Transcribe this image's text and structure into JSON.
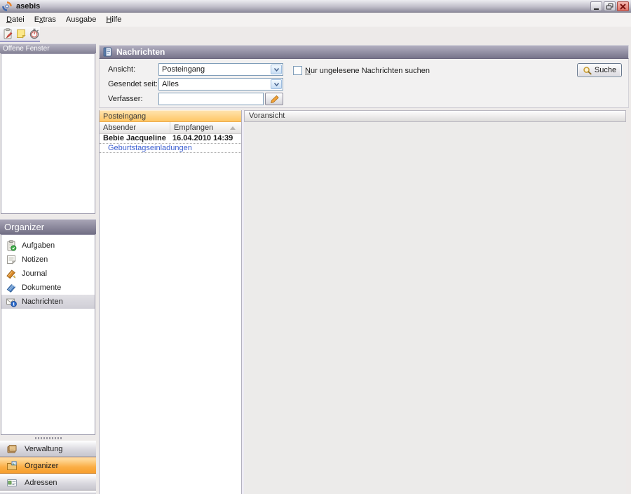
{
  "window": {
    "title": "asebis"
  },
  "menu": {
    "items": [
      {
        "label": "Datei",
        "accel": 0
      },
      {
        "label": "Extras",
        "accel": 1
      },
      {
        "label": "Ausgabe",
        "accel": -1
      },
      {
        "label": "Hilfe",
        "accel": 0
      }
    ]
  },
  "sidebar": {
    "open_windows_title": "Offene Fenster",
    "organizer_title": "Organizer",
    "organizer_items": [
      {
        "label": "Aufgaben"
      },
      {
        "label": "Notizen"
      },
      {
        "label": "Journal"
      },
      {
        "label": "Dokumente"
      },
      {
        "label": "Nachrichten"
      }
    ],
    "nav_buttons": [
      {
        "label": "Verwaltung"
      },
      {
        "label": "Organizer"
      },
      {
        "label": "Adressen"
      }
    ]
  },
  "main": {
    "title": "Nachrichten",
    "form": {
      "ansicht_label": "Ansicht:",
      "ansicht_value": "Posteingang",
      "gesendet_label": "Gesendet seit:",
      "gesendet_value": "Alles",
      "verfasser_label": "Verfasser:",
      "verfasser_value": "",
      "unread_checkbox": {
        "label": "Nur ungelesene Nachrichten suchen",
        "accel": 0,
        "checked": false
      },
      "search_button_label": "Suche"
    },
    "inbox": {
      "title": "Posteingang",
      "columns": [
        "Absender",
        "Empfangen"
      ],
      "rows": [
        {
          "sender": "Bebie Jacqueline",
          "received": "16.04.2010 14:39",
          "subject": "Geburtstagseinladungen"
        }
      ]
    },
    "preview_title": "Voransicht"
  },
  "colors": {
    "header_top": "#ACA9BC",
    "header_bottom": "#716E84",
    "inbox_header_top": "#FFE2AC",
    "inbox_header_bottom": "#FFC766",
    "nav_selected_top": "#FFDFA6",
    "nav_selected_bottom": "#F79E2C",
    "link_blue": "#3C5FD1",
    "close_button_red": "#E1756A"
  }
}
